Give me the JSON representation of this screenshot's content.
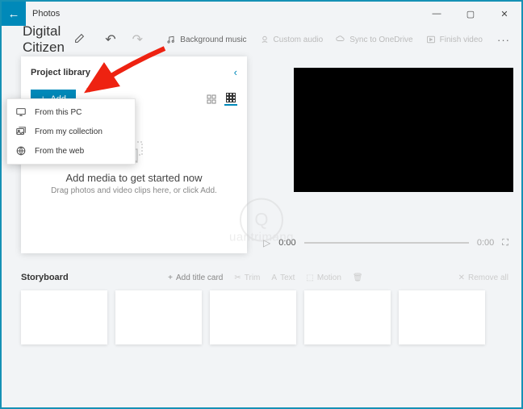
{
  "app_title": "Photos",
  "project_title": "Digital Citizen",
  "header_actions": {
    "bg_music": "Background music",
    "custom_audio": "Custom audio",
    "sync": "Sync to OneDrive",
    "finish": "Finish video"
  },
  "library": {
    "title": "Project library",
    "add_label": "Add",
    "empty_title": "Add media to get started now",
    "empty_sub": "Drag photos and video clips here, or click Add."
  },
  "add_menu": {
    "from_pc": "From this PC",
    "from_collection": "From my collection",
    "from_web": "From the web"
  },
  "player": {
    "current_time": "0:00",
    "total_time": "0:00"
  },
  "storyboard": {
    "title": "Storyboard",
    "add_title_card": "Add title card",
    "trim": "Trim",
    "text": "Text",
    "motion": "Motion",
    "remove_all": "Remove all"
  },
  "watermark_text": "uantrimang"
}
